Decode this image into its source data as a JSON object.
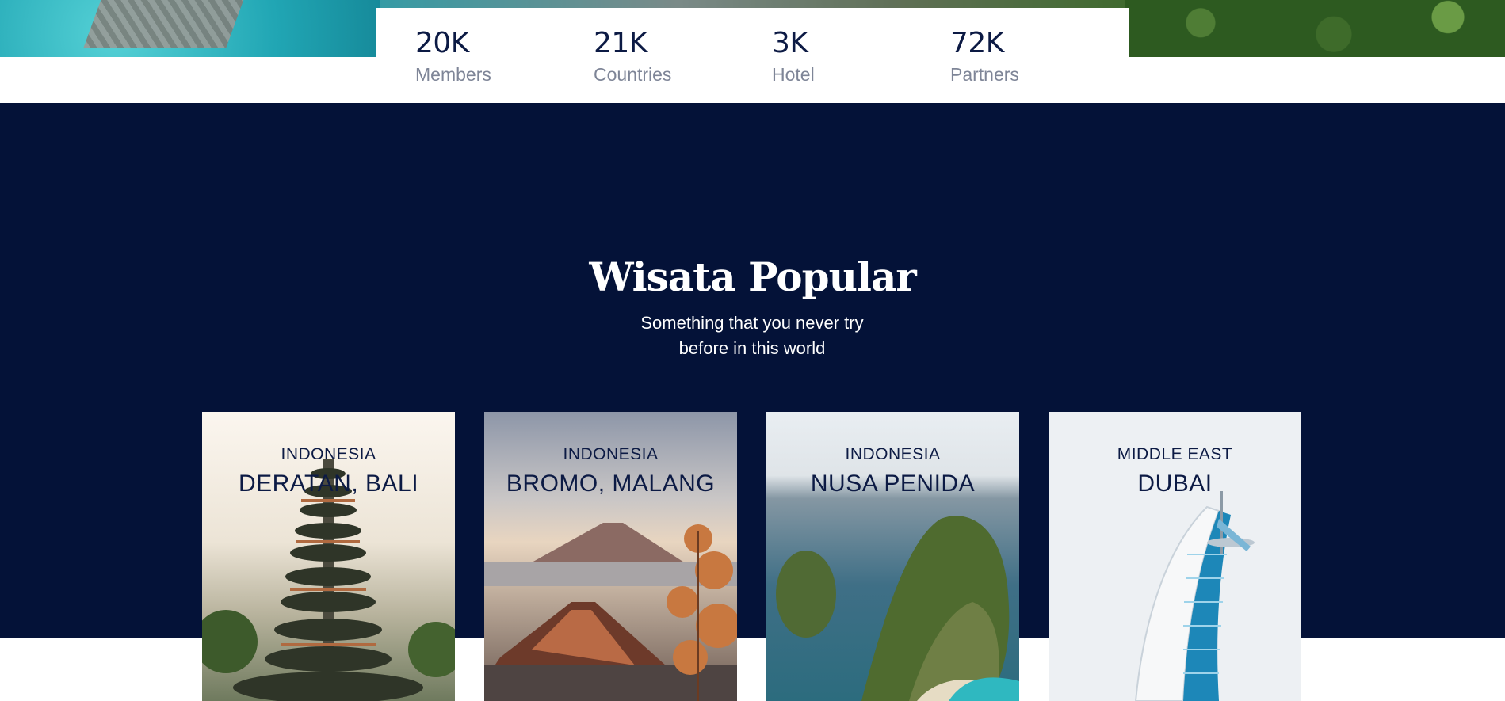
{
  "stats": [
    {
      "value": "20K",
      "label": "Members"
    },
    {
      "value": "21K",
      "label": "Countries"
    },
    {
      "value": "3K",
      "label": "Hotel"
    },
    {
      "value": "72K",
      "label": "Partners"
    }
  ],
  "section": {
    "title": "Wisata Popular",
    "subtitle": "Something that you never try before in this world"
  },
  "destinations": [
    {
      "region": "INDONESIA",
      "name": "DERATAN, BALI"
    },
    {
      "region": "INDONESIA",
      "name": "BROMO, MALANG"
    },
    {
      "region": "INDONESIA",
      "name": "NUSA PENIDA"
    },
    {
      "region": "MIDDLE EAST",
      "name": "DUBAI"
    }
  ],
  "colors": {
    "navy": "#041238",
    "text_dark": "#0c1a44",
    "label_gray": "#7e8597"
  }
}
